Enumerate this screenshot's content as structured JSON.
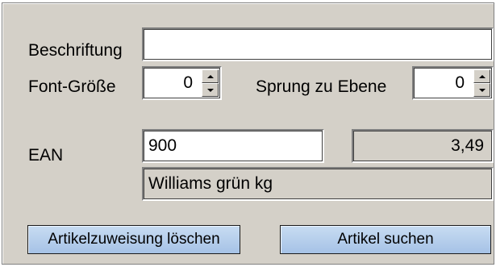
{
  "labels": {
    "beschriftung": "Beschriftung",
    "font_groesse": "Font-Größe",
    "sprung_zu_ebene": "Sprung zu Ebene",
    "ean": "EAN"
  },
  "fields": {
    "beschriftung_value": "",
    "font_groesse_value": "0",
    "sprung_zu_ebene_value": "0",
    "ean_value": "900",
    "price_value": "3,49",
    "article_name": "Williams grün kg"
  },
  "buttons": {
    "clear_assignment": "Artikelzuweisung löschen",
    "search_article": "Artikel suchen"
  },
  "colors": {
    "panel_bg": "#d4d0c8",
    "button_bg": "#a6c2e6"
  },
  "icons": {
    "spin_up": "arrow-up-icon",
    "spin_down": "arrow-down-icon"
  }
}
